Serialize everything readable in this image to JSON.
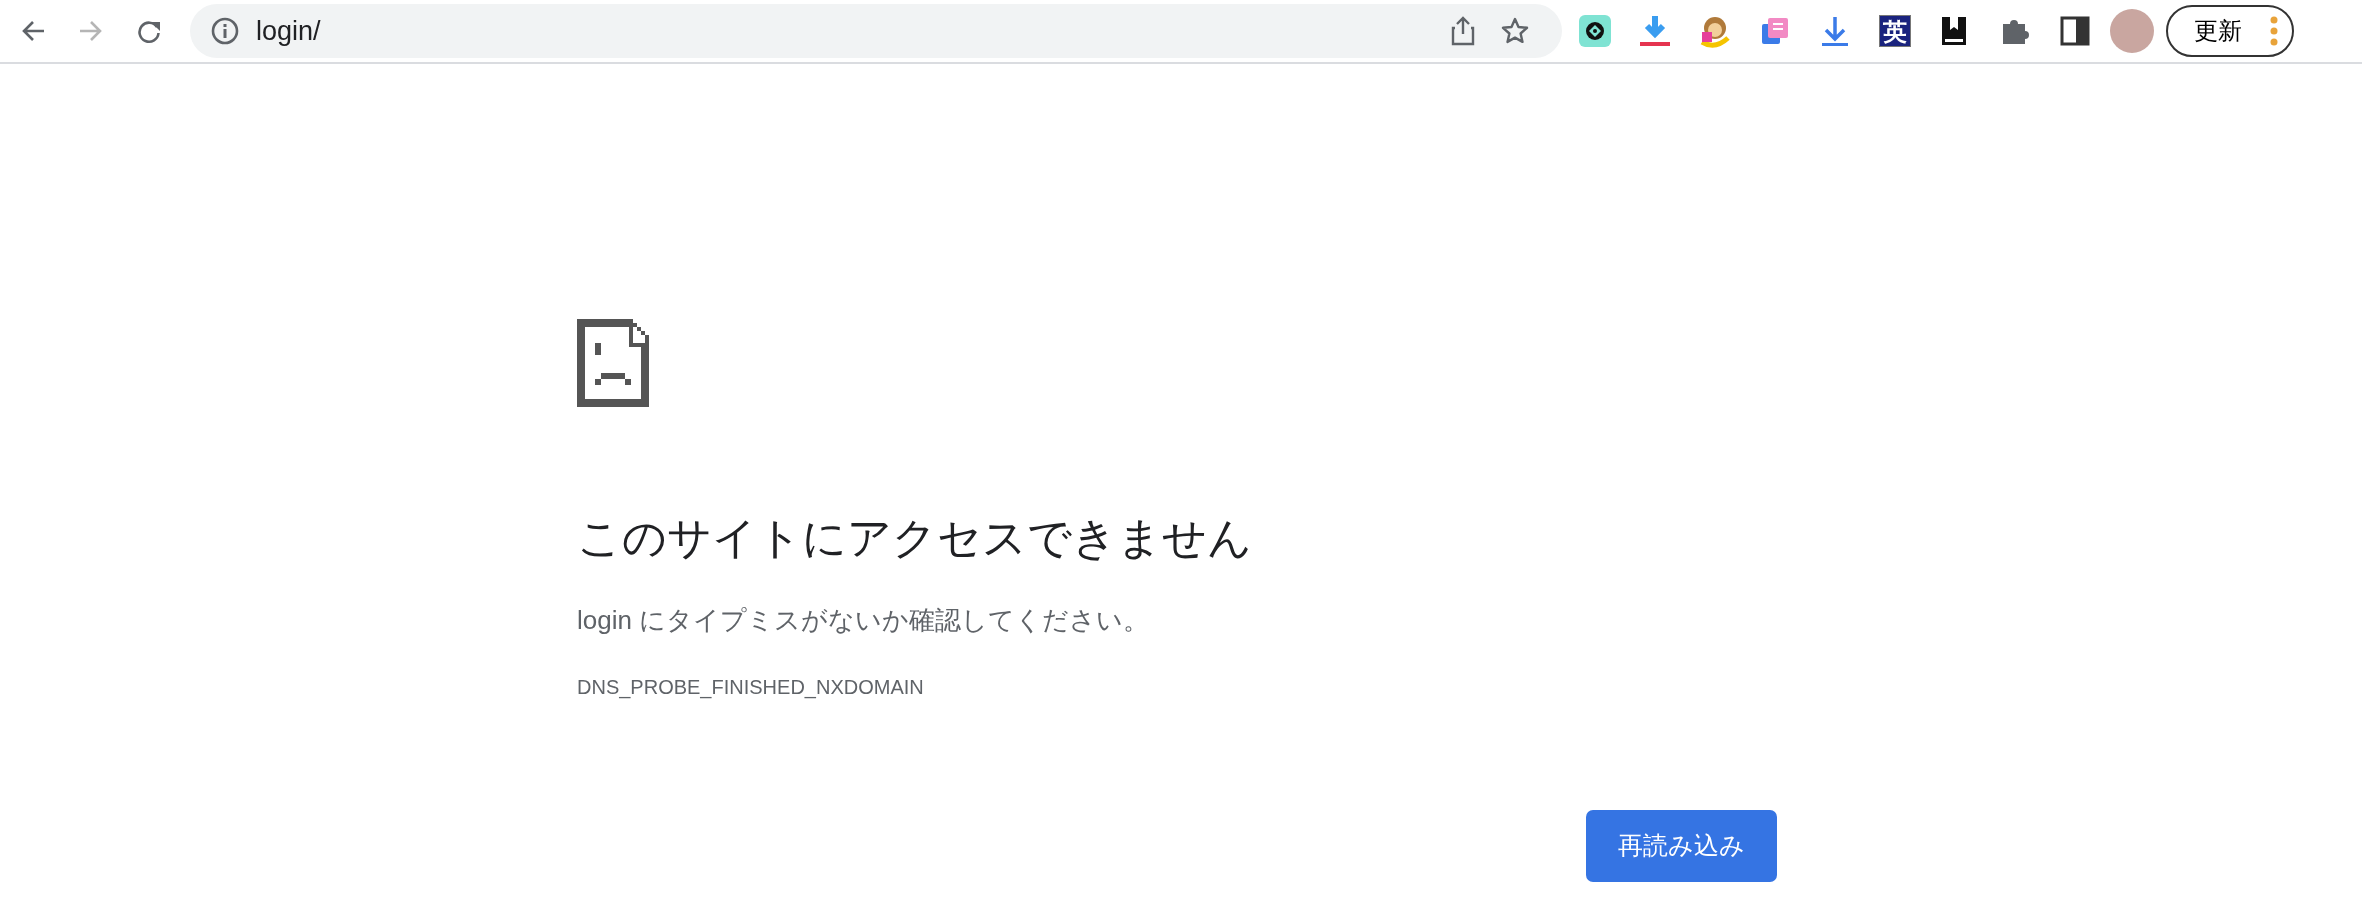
{
  "toolbar": {
    "nav_buttons": [
      {
        "kind": "back",
        "disabled": false
      },
      {
        "kind": "forward",
        "disabled": true
      },
      {
        "kind": "reload",
        "disabled": false
      }
    ],
    "address": "login/",
    "extensions": [
      {
        "kind": "badge"
      },
      {
        "kind": "download-red"
      },
      {
        "kind": "monkey"
      },
      {
        "kind": "notes"
      },
      {
        "kind": "download"
      },
      {
        "kind": "letter",
        "label": "英"
      },
      {
        "kind": "bookmark"
      },
      {
        "kind": "puzzle"
      },
      {
        "kind": "sidepanel"
      }
    ],
    "update_button": "更新"
  },
  "error": {
    "title": "このサイトにアクセスできません",
    "message": "login にタイプミスがないか確認してください。",
    "code": "DNS_PROBE_FINISHED_NXDOMAIN",
    "reload_button": "再読み込み"
  }
}
